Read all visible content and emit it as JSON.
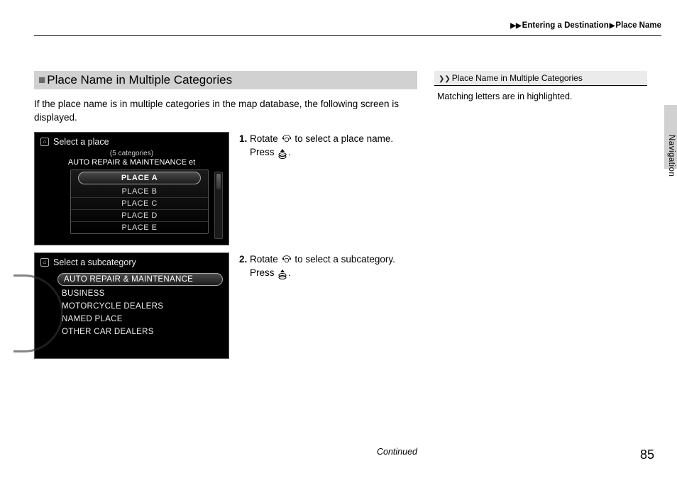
{
  "breadcrumb": {
    "level1": "Entering a Destination",
    "level2": "Place Name"
  },
  "section_title": "Place Name in Multiple Categories",
  "intro": "If the place name is in multiple categories in the map database, the following screen is displayed.",
  "screen1": {
    "title": "Select a place",
    "subhead": "(5 categories)",
    "subline": "AUTO REPAIR & MAINTENANCE et",
    "items": [
      "PLACE A",
      "PLACE B",
      "PLACE C",
      "PLACE D",
      "PLACE E"
    ]
  },
  "screen2": {
    "title": "Select a subcategory",
    "items": [
      "AUTO REPAIR & MAINTENANCE",
      "BUSINESS",
      "MOTORCYCLE DEALERS",
      "NAMED PLACE",
      "OTHER CAR DEALERS"
    ]
  },
  "step1": {
    "num": "1.",
    "line1a": "Rotate",
    "line1b": "to select a place name.",
    "line2a": "Press",
    "line2b": "."
  },
  "step2": {
    "num": "2.",
    "line1a": "Rotate",
    "line1b": "to select a subcategory.",
    "line2a": "Press",
    "line2b": "."
  },
  "sidebar": {
    "heading": "Place Name in Multiple Categories",
    "note": "Matching letters are in highlighted."
  },
  "side_label": "Navigation",
  "continued": "Continued",
  "page": "85"
}
